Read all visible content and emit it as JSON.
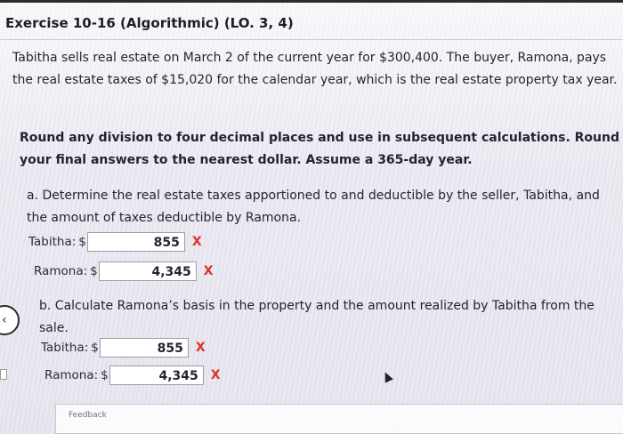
{
  "exercise": {
    "title": "Exercise 10-16 (Algorithmic) (LO. 3, 4)"
  },
  "intro": {
    "text": "Tabitha sells real estate on March 2 of the current year for $300,400. The buyer, Ramona, pays the real estate taxes of $15,020 for the calendar year, which is the real estate property tax year."
  },
  "instructions": {
    "text": "Round any division to four decimal places and use in subsequent calculations. Round your final answers to the nearest dollar. Assume a 365-day year."
  },
  "part_a": {
    "prompt": "a. Determine the real estate taxes apportioned to and deductible by the seller, Tabitha, and the amount of taxes deductible by Ramona.",
    "tabitha_label": "Tabitha:",
    "tabitha_value": "855",
    "ramona_label": "Ramona:",
    "ramona_value": "4,345"
  },
  "part_b": {
    "prompt": "b. Calculate Ramona’s basis in the property and the amount realized by Tabitha from the sale.",
    "tabitha_label": "Tabitha:",
    "tabitha_value": "855",
    "ramona_label": "Ramona:",
    "ramona_value": "4,345"
  },
  "currency_symbol": "$",
  "wrong_mark": "X",
  "feedback": {
    "label": "Feedback"
  },
  "colors": {
    "wrong": "#e0302b",
    "text": "#1f2430"
  },
  "icons": {
    "wrong": "x-mark-icon",
    "cursor": "mouse-cursor-icon",
    "nav": "chevron-left-icon"
  }
}
